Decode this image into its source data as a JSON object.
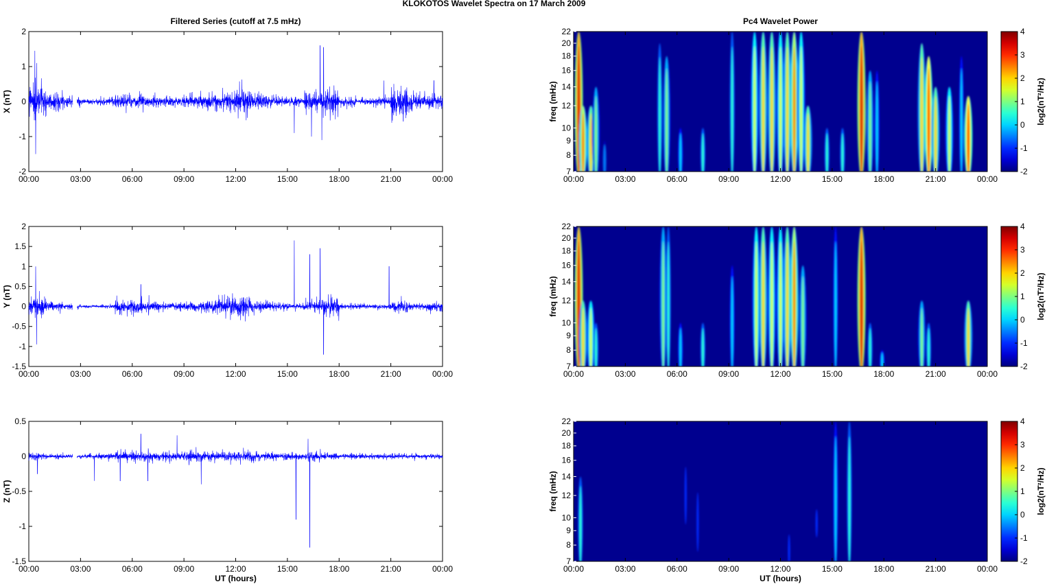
{
  "title": "KLOKOTOS Wavelet Spectra on 17 March     2009",
  "chart_data": [
    {
      "type": "line",
      "title": "Filtered Series (cutoff at 7.5 mHz)",
      "ylabel": "X (nT)",
      "xlabel": "",
      "ylim": [
        -2,
        2
      ],
      "yticks": [
        "-2",
        "-1",
        "0",
        "1",
        "2"
      ],
      "ytickvals": [
        -2,
        -1,
        0,
        1,
        2
      ],
      "envelope_per_hour": [
        0.35,
        0.2,
        0.12,
        0.05,
        0.08,
        0.15,
        0.15,
        0.12,
        0.12,
        0.15,
        0.2,
        0.25,
        0.3,
        0.2,
        0.12,
        0.1,
        0.22,
        0.3,
        0.1,
        0.08,
        0.1,
        0.35,
        0.2,
        0.15
      ],
      "spikes": [
        [
          0.35,
          1.45
        ],
        [
          0.4,
          -1.5
        ],
        [
          0.45,
          1.1
        ],
        [
          16.9,
          1.6
        ],
        [
          17.1,
          1.55
        ],
        [
          17.0,
          -1.1
        ],
        [
          16.4,
          -1.0
        ],
        [
          15.4,
          -0.9
        ],
        [
          20.6,
          0.6
        ],
        [
          23.5,
          0.6
        ],
        [
          21.6,
          0.45
        ]
      ]
    },
    {
      "type": "line",
      "ylabel": "Y (nT)",
      "xlabel": "",
      "ylim": [
        -1.5,
        2
      ],
      "yticks": [
        "-1.5",
        "-1",
        "-0.5",
        "0",
        "0.5",
        "1",
        "1.5",
        "2"
      ],
      "ytickvals": [
        -1.5,
        -1,
        -0.5,
        0,
        0.5,
        1,
        1.5,
        2
      ],
      "envelope_per_hour": [
        0.2,
        0.1,
        0.05,
        0.03,
        0.04,
        0.15,
        0.15,
        0.08,
        0.08,
        0.1,
        0.12,
        0.18,
        0.2,
        0.12,
        0.08,
        0.06,
        0.12,
        0.2,
        0.05,
        0.05,
        0.05,
        0.12,
        0.08,
        0.1
      ],
      "spikes": [
        [
          0.4,
          1.0
        ],
        [
          0.45,
          -0.95
        ],
        [
          15.4,
          1.65
        ],
        [
          16.3,
          1.3
        ],
        [
          16.9,
          1.45
        ],
        [
          17.1,
          -1.2
        ],
        [
          20.9,
          1.0
        ],
        [
          6.5,
          0.55
        ]
      ]
    },
    {
      "type": "line",
      "ylabel": "Z (nT)",
      "xlabel": "UT (hours)",
      "ylim": [
        -1.5,
        0.5
      ],
      "yticks": [
        "-1.5",
        "-1",
        "-0.5",
        "0",
        "0.5"
      ],
      "ytickvals": [
        -1.5,
        -1,
        -0.5,
        0,
        0.5
      ],
      "envelope_per_hour": [
        0.04,
        0.03,
        0.02,
        0.03,
        0.04,
        0.06,
        0.06,
        0.05,
        0.05,
        0.06,
        0.06,
        0.06,
        0.06,
        0.05,
        0.04,
        0.04,
        0.05,
        0.04,
        0.03,
        0.03,
        0.03,
        0.03,
        0.03,
        0.03
      ],
      "spikes": [
        [
          6.5,
          0.32
        ],
        [
          8.6,
          0.3
        ],
        [
          15.5,
          -0.9
        ],
        [
          16.3,
          -1.3
        ],
        [
          16.2,
          0.25
        ],
        [
          5.3,
          -0.35
        ],
        [
          0.5,
          -0.25
        ],
        [
          3.8,
          -0.35
        ],
        [
          6.9,
          -0.35
        ],
        [
          10.0,
          -0.4
        ]
      ]
    },
    {
      "type": "heatmap",
      "title": "Pc4 Wavelet Power",
      "ylabel": "freq (mHz)",
      "xlabel": "",
      "clabel": "log2(nT²/Hz)",
      "clim": [
        -2,
        4
      ],
      "bursts_t_fmin_fmax_power": [
        [
          0.3,
          7,
          22,
          3.5
        ],
        [
          0.55,
          7,
          12,
          2.5
        ],
        [
          1.0,
          7,
          12,
          2
        ],
        [
          1.3,
          7,
          14,
          1
        ],
        [
          1.8,
          7,
          9,
          -0.5
        ],
        [
          5.0,
          7,
          20,
          0.5
        ],
        [
          5.4,
          7,
          18,
          1
        ],
        [
          6.2,
          7,
          10,
          0
        ],
        [
          7.5,
          7,
          10,
          0.5
        ],
        [
          9.2,
          7,
          22,
          0.5
        ],
        [
          10.5,
          7,
          22,
          1.5
        ],
        [
          11.0,
          7,
          22,
          2
        ],
        [
          11.5,
          7,
          22,
          2
        ],
        [
          12.0,
          7,
          22,
          1.5
        ],
        [
          12.4,
          7,
          22,
          2
        ],
        [
          12.8,
          7,
          22,
          2.5
        ],
        [
          13.2,
          7,
          22,
          1.5
        ],
        [
          13.6,
          7,
          12,
          2
        ],
        [
          14.7,
          7,
          10,
          0.5
        ],
        [
          15.6,
          7,
          10,
          0.5
        ],
        [
          16.7,
          7,
          22,
          3.5
        ],
        [
          17.2,
          7,
          16,
          1
        ],
        [
          17.6,
          7,
          16,
          0
        ],
        [
          20.2,
          7,
          20,
          2
        ],
        [
          20.6,
          7,
          18,
          3
        ],
        [
          21.0,
          7,
          14,
          2
        ],
        [
          21.8,
          7,
          14,
          1.5
        ],
        [
          22.9,
          7,
          13,
          3
        ],
        [
          22.5,
          7,
          18,
          0
        ]
      ]
    },
    {
      "type": "heatmap",
      "ylabel": "freq (mHz)",
      "xlabel": "",
      "clabel": "log2(nT²/Hz)",
      "clim": [
        -2,
        4
      ],
      "bursts_t_fmin_fmax_power": [
        [
          0.3,
          7,
          22,
          3.5
        ],
        [
          0.55,
          7,
          12,
          2
        ],
        [
          1.0,
          7,
          12,
          1.5
        ],
        [
          1.3,
          7,
          10,
          0.5
        ],
        [
          5.2,
          7,
          22,
          1
        ],
        [
          5.5,
          7,
          22,
          0.5
        ],
        [
          6.2,
          7,
          10,
          0
        ],
        [
          7.5,
          7,
          10,
          0.5
        ],
        [
          9.2,
          7,
          16,
          0
        ],
        [
          10.6,
          7,
          22,
          1.5
        ],
        [
          11.0,
          7,
          22,
          2
        ],
        [
          11.5,
          7,
          22,
          1.5
        ],
        [
          12.0,
          7,
          22,
          1.5
        ],
        [
          12.4,
          7,
          22,
          2
        ],
        [
          12.8,
          7,
          22,
          2.5
        ],
        [
          13.3,
          7,
          16,
          1
        ],
        [
          15.2,
          7,
          22,
          0
        ],
        [
          16.7,
          7,
          22,
          3.5
        ],
        [
          17.2,
          7,
          10,
          0.5
        ],
        [
          17.9,
          7,
          8,
          0
        ],
        [
          20.2,
          7,
          12,
          1
        ],
        [
          20.6,
          7,
          10,
          0.5
        ],
        [
          22.9,
          7,
          12,
          2
        ]
      ]
    },
    {
      "type": "heatmap",
      "ylabel": "freq (mHz)",
      "xlabel": "UT (hours)",
      "clabel": "log2(nT²/Hz)",
      "clim": [
        -2,
        4
      ],
      "bursts_t_fmin_fmax_power": [
        [
          0.4,
          7,
          14,
          0.5
        ],
        [
          15.2,
          7,
          22,
          0
        ],
        [
          16.0,
          7,
          22,
          0.5
        ],
        [
          6.5,
          10,
          16,
          -1
        ],
        [
          7.2,
          8,
          13,
          -1
        ],
        [
          12.5,
          7,
          9,
          -1
        ],
        [
          14.1,
          9,
          11,
          -1
        ]
      ]
    }
  ],
  "xticks": [
    "00:00",
    "03:00",
    "06:00",
    "09:00",
    "12:00",
    "15:00",
    "18:00",
    "21:00",
    "00:00"
  ],
  "freq_ticks": [
    "7",
    "8",
    "9",
    "10",
    "12",
    "14",
    "16",
    "18",
    "20",
    "22"
  ],
  "cbar_ticks": [
    "-2",
    "-1",
    "0",
    "1",
    "2",
    "3",
    "4"
  ],
  "colors": {
    "line": "#0000ff",
    "bg": "#00008f"
  }
}
